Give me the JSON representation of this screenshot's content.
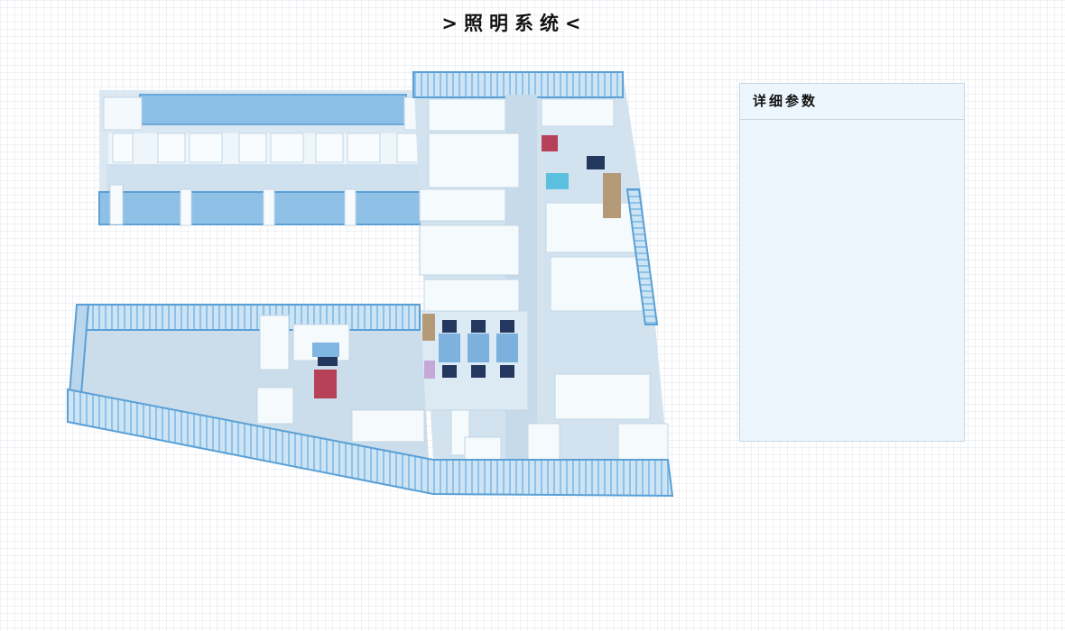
{
  "page": {
    "title": ">照明系统<"
  },
  "details_panel": {
    "title": "详细参数"
  },
  "colors": {
    "glass": "#7fb6e2",
    "wall": "#f3f8fc",
    "floor": "#cfe0ee",
    "room_red": "#b8415a",
    "room_cyan": "#5cbfe0",
    "room_tan": "#b59a78",
    "room_lilac": "#c6a8d8",
    "room_dark": "#24375e"
  }
}
